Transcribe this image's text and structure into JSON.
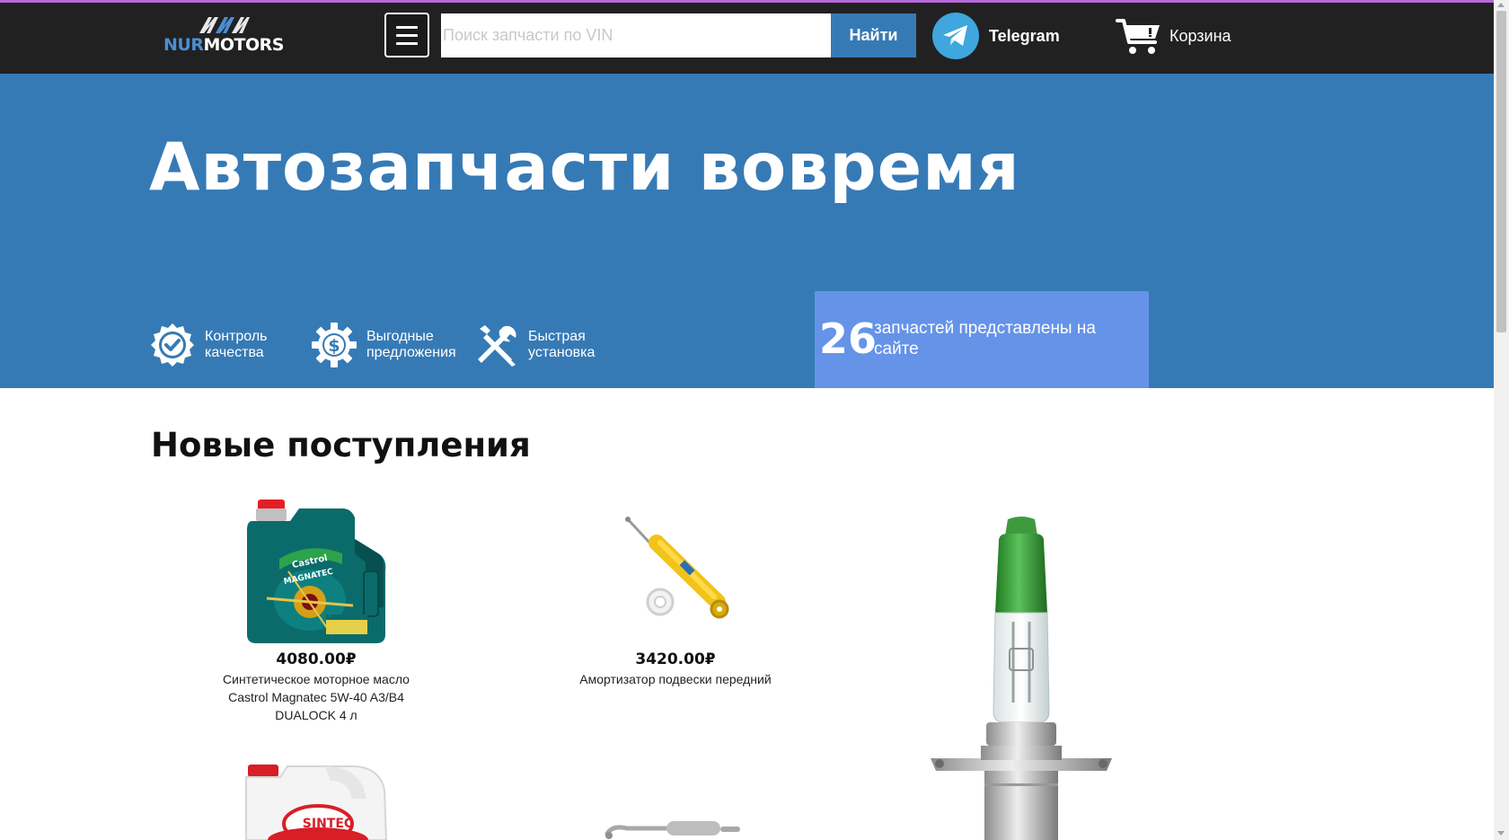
{
  "header": {
    "logo": {
      "prefix": "NUR",
      "suffix": "MOTORS"
    },
    "search": {
      "placeholder": "Поиск запчасти по VIN",
      "value": "",
      "button_label": "Найти"
    },
    "telegram_label": "Telegram",
    "cart_label": "Корзина",
    "colors": {
      "background": "#212121",
      "accent": "#367ab5",
      "telegram": "#3fa6de"
    }
  },
  "hero": {
    "title": "Автозапчасти вовремя",
    "features": [
      {
        "icon": "check-badge-icon",
        "label_line1": "Контроль",
        "label_line2": "качества"
      },
      {
        "icon": "dollar-gear-icon",
        "label_line1": "Выгодные",
        "label_line2": "предложения"
      },
      {
        "icon": "wrench-screwdriver-icon",
        "label_line1": "Быстрая",
        "label_line2": "установка"
      }
    ],
    "counter": {
      "number": "26",
      "text": "запчастей представлены на сайте"
    },
    "colors": {
      "background": "#367ab5",
      "counter_box": "#6593e8"
    }
  },
  "new_arrivals": {
    "title": "Новые поступления",
    "products": [
      {
        "icon": "oil-canister-icon",
        "price": "4080.00₽",
        "name": "Синтетическое моторное масло Castrol Magnatec 5W-40 A3/B4 DUALOCK 4 л"
      },
      {
        "icon": "shock-absorber-icon",
        "price": "3420.00₽",
        "name": "Амортизатор подвески передний"
      },
      {
        "icon": "headlight-bulb-icon",
        "price": "",
        "name": ""
      },
      {
        "icon": "antifreeze-canister-icon",
        "price": "",
        "name": "",
        "brand_label": "SINTEC"
      },
      {
        "icon": "exhaust-muffler-icon",
        "price": "",
        "name": ""
      }
    ]
  }
}
